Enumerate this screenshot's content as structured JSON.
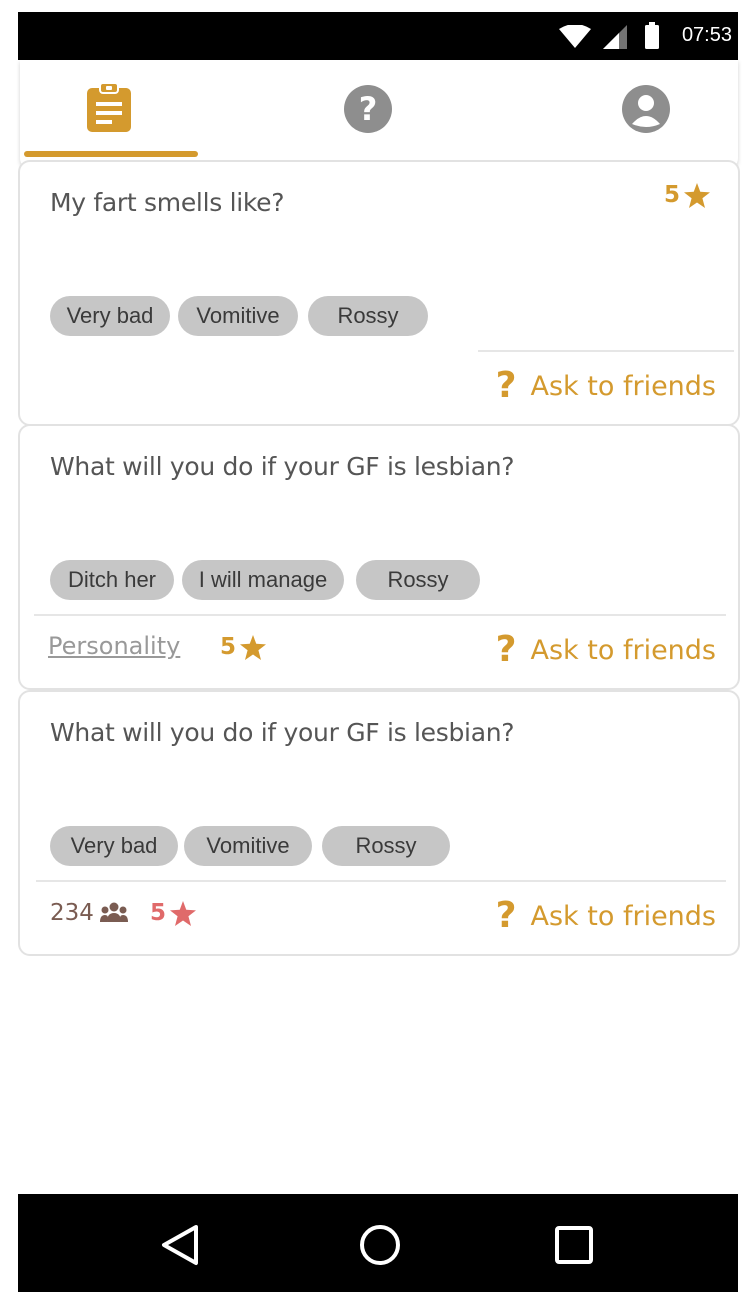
{
  "status_bar": {
    "time": "07:53",
    "icons": [
      "wifi-icon",
      "cell-signal-icon",
      "battery-icon"
    ]
  },
  "tabs": [
    {
      "icon": "clipboard-icon",
      "active": true
    },
    {
      "icon": "help-icon",
      "active": false
    },
    {
      "icon": "profile-icon",
      "active": false
    }
  ],
  "colors": {
    "accent": "#d49a2e",
    "chip_bg": "#c6c6c6",
    "rating_alt": "#e06a6a",
    "participants": "#7a5c52"
  },
  "cards": [
    {
      "question": "My fart smells like?",
      "options": [
        "Very bad",
        "Vomitive",
        "Rossy"
      ],
      "rating": "5",
      "ask_label": "Ask to friends"
    },
    {
      "question": "What will you do if your GF is lesbian?",
      "options": [
        "Ditch her",
        "I will manage",
        "Rossy"
      ],
      "category": "Personality",
      "rating": "5",
      "ask_label": "Ask to friends"
    },
    {
      "question": "What will you do if your GF is lesbian?",
      "options": [
        "Very bad",
        "Vomitive",
        "Rossy"
      ],
      "participants": "234",
      "rating": "5",
      "ask_label": "Ask to friends"
    }
  ],
  "nav_bar": {
    "icons": [
      "back-icon",
      "home-icon",
      "recents-icon"
    ]
  }
}
